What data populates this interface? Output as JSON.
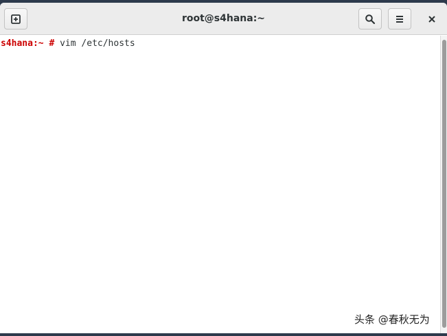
{
  "window": {
    "title": "root@s4hana:~"
  },
  "toolbar": {
    "new_tab_icon": "new-tab-icon",
    "search_icon": "search-icon",
    "menu_icon": "hamburger-menu-icon",
    "close_icon": "close-icon"
  },
  "terminal": {
    "prompt": "s4hana:~ #",
    "command": " vim /etc/hosts"
  },
  "watermark": {
    "text": "头条 @春秋无为"
  },
  "colors": {
    "prompt": "#cc0000",
    "titlebar": "#ececec",
    "terminal_bg": "#ffffff"
  }
}
